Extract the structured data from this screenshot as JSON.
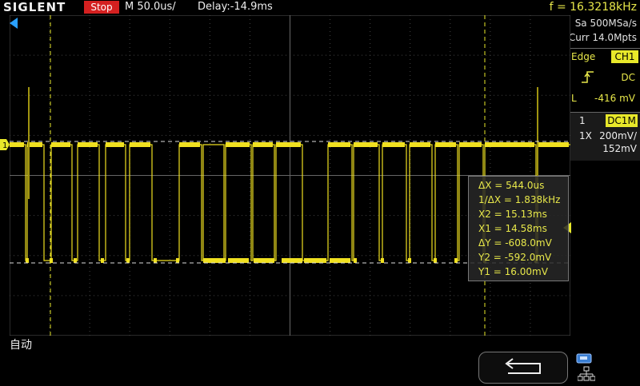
{
  "header": {
    "brand": "SIGLENT",
    "run_state": "Stop",
    "timebase": "M 50.0us/",
    "delay": "Delay:-14.9ms",
    "frequency": "f = 16.3218kHz"
  },
  "acquisition": {
    "sample_rate": "Sa 500MSa/s",
    "memory_depth": "Curr 14.0Mpts"
  },
  "trigger": {
    "mode": "Edge",
    "source": "CH1",
    "edge_icon": "rising-edge-icon",
    "coupling": "DC",
    "level_label": "L",
    "level": "-416 mV"
  },
  "channel": {
    "number": "1",
    "coupling": "DC1M",
    "probe": "1X",
    "scale": "200mV/",
    "offset": "152mV",
    "marker": "1"
  },
  "measurements": {
    "dx": "ΔX = 544.0us",
    "inv_dx": "1/ΔX = 1.838kHz",
    "x2": "X2 = 15.13ms",
    "x1": "X1 = 14.58ms",
    "dy": "ΔY = -608.0mV",
    "y2": "Y2 = -592.0mV",
    "y1": "Y1 = 16.00mV"
  },
  "footer": {
    "status": "自动",
    "back_icon": "back-arrow-icon",
    "usb_icon": "usb-icon",
    "lan_icon": "lan-icon"
  },
  "colors": {
    "trace": "#f0e020",
    "accent": "#e8e82a",
    "stop": "#d42020"
  }
}
